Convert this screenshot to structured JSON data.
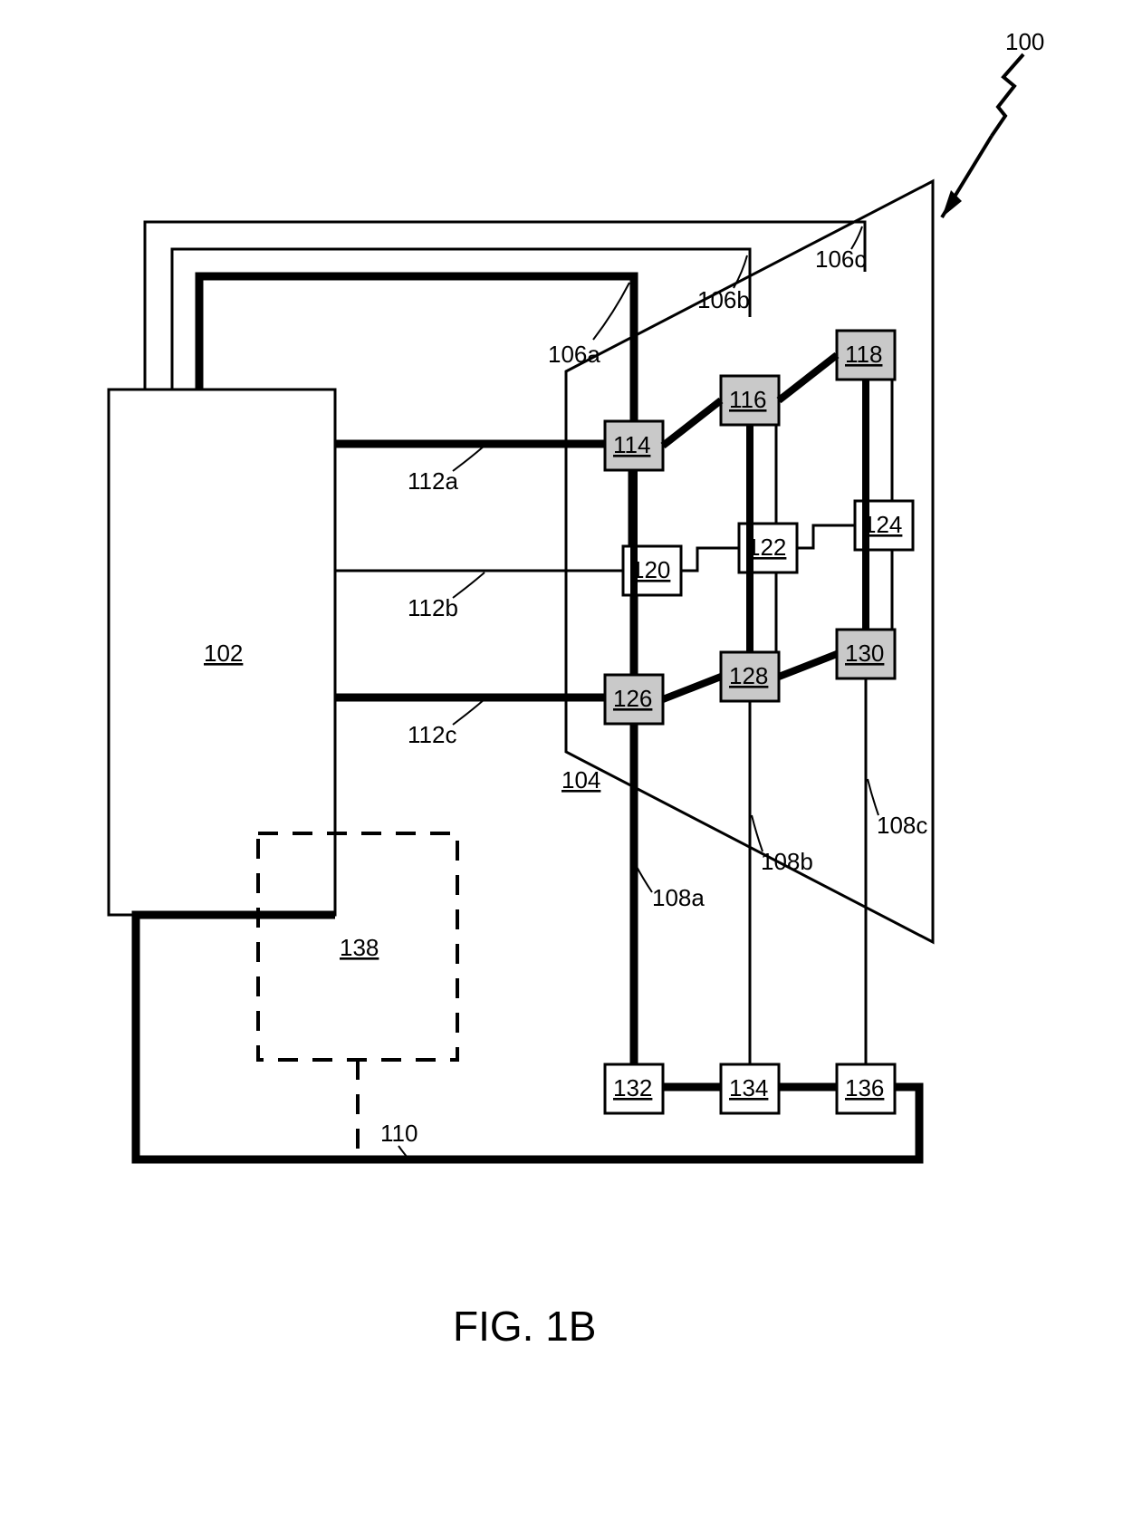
{
  "figure_label": "FIG. 1B",
  "system_ref": "100",
  "blocks": {
    "main": "102",
    "trapezoid": "104",
    "dashed": "138",
    "b114": "114",
    "b116": "116",
    "b118": "118",
    "b120": "120",
    "b122": "122",
    "b124": "124",
    "b126": "126",
    "b128": "128",
    "b130": "130",
    "b132": "132",
    "b134": "134",
    "b136": "136"
  },
  "labels": {
    "l106a": "106a",
    "l106b": "106b",
    "l106c": "106c",
    "l108a": "108a",
    "l108b": "108b",
    "l108c": "108c",
    "l110": "110",
    "l112a": "112a",
    "l112b": "112b",
    "l112c": "112c"
  }
}
